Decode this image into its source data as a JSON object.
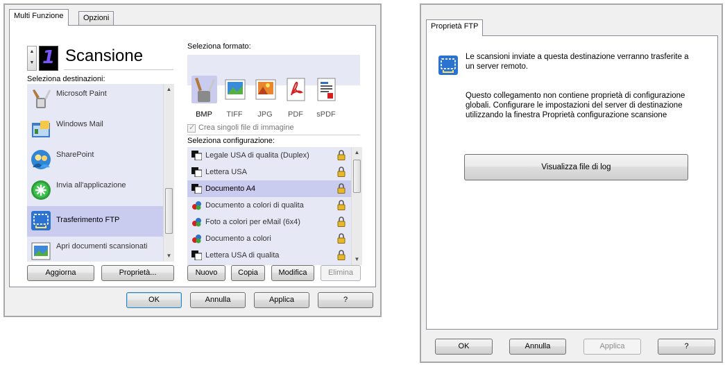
{
  "left": {
    "tabs": [
      "Multi Funzione",
      "Opzioni"
    ],
    "counter": "1",
    "title": "Scansione",
    "destinations_label": "Seleziona destinazioni:",
    "destinations": [
      {
        "label": "Microsoft Paint",
        "icon": "paint-brush-icon"
      },
      {
        "label": "Windows Mail",
        "icon": "mail-icon"
      },
      {
        "label": "SharePoint",
        "icon": "sharepoint-icon"
      },
      {
        "label": "Invia all'applicazione",
        "icon": "send-to-app-icon"
      },
      {
        "label": "Trasferimento FTP",
        "icon": "ftp-icon",
        "selected": true
      },
      {
        "label": "Apri documenti scansionati",
        "icon": "open-document-icon"
      }
    ],
    "format_label": "Seleziona formato:",
    "formats": [
      {
        "label": "BMP",
        "selected": true
      },
      {
        "label": "TIFF"
      },
      {
        "label": "JPG"
      },
      {
        "label": "PDF"
      },
      {
        "label": "sPDF"
      }
    ],
    "single_files_label": "Crea singoli file di immagine",
    "single_files_checked": true,
    "config_label": "Seleziona configurazione:",
    "configs": [
      {
        "label": "Legale USA di qualita (Duplex)",
        "type": "bw"
      },
      {
        "label": "Lettera USA",
        "type": "bw"
      },
      {
        "label": "Documento A4",
        "type": "bw",
        "selected": true
      },
      {
        "label": "Documento a colori di qualita",
        "type": "color"
      },
      {
        "label": "Foto a colori per eMail (6x4)",
        "type": "color"
      },
      {
        "label": "Documento a colori",
        "type": "color"
      },
      {
        "label": "Lettera USA di qualita",
        "type": "bw"
      }
    ],
    "buttons": {
      "aggiorna": "Aggiorna",
      "proprieta": "Proprietà...",
      "nuovo": "Nuovo",
      "copia": "Copia",
      "modifica": "Modifica",
      "elimina": "Elimina",
      "ok": "OK",
      "annulla": "Annulla",
      "applica": "Applica",
      "help": "?"
    }
  },
  "right": {
    "tab": "Proprietà FTP",
    "description": "Le scansioni inviate a questa destinazione verranno trasferite a un server remoto.",
    "note": "Questo collegamento non contiene proprietà di configurazione globali. Configurare le impostazioni del server di destinazione utilizzando la finestra Proprietà configurazione scansione",
    "log_button": "Visualizza file di log",
    "buttons": {
      "ok": "OK",
      "annulla": "Annulla",
      "applica": "Applica",
      "help": "?"
    }
  },
  "colors": {
    "selection": "#c9cbef",
    "list_bg": "#e7e8f6",
    "accent": "#2a6fc9"
  }
}
